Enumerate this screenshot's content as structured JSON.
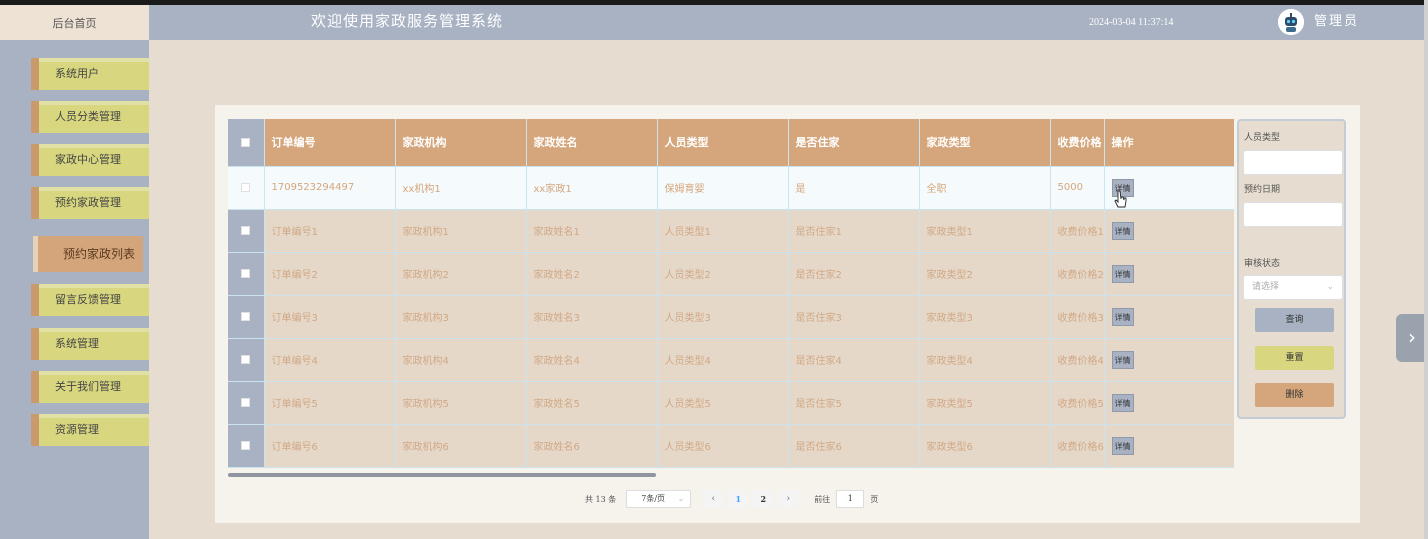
{
  "header": {
    "home_label": "后台首页",
    "system_title": "欢迎使用家政服务管理系统",
    "datetime": "2024-03-04 11:37:14",
    "admin_label": "管理员"
  },
  "sidebar": {
    "items": [
      {
        "label": "系统用户"
      },
      {
        "label": "人员分类管理"
      },
      {
        "label": "家政中心管理"
      },
      {
        "label": "预约家政管理"
      },
      {
        "label": "预约家政列表"
      },
      {
        "label": "留言反馈管理"
      },
      {
        "label": "系统管理"
      },
      {
        "label": "关于我们管理"
      },
      {
        "label": "资源管理"
      }
    ]
  },
  "table": {
    "headers": [
      "订单编号",
      "家政机构",
      "家政姓名",
      "人员类型",
      "是否住家",
      "家政类型",
      "收费价格",
      "操作"
    ],
    "detail_label": "详情",
    "rows": [
      [
        "1709523294497",
        "xx机构1",
        "xx家政1",
        "保姆育婴",
        "是",
        "全职",
        "5000"
      ],
      [
        "订单编号1",
        "家政机构1",
        "家政姓名1",
        "人员类型1",
        "是否住家1",
        "家政类型1",
        "收费价格1"
      ],
      [
        "订单编号2",
        "家政机构2",
        "家政姓名2",
        "人员类型2",
        "是否住家2",
        "家政类型2",
        "收费价格2"
      ],
      [
        "订单编号3",
        "家政机构3",
        "家政姓名3",
        "人员类型3",
        "是否住家3",
        "家政类型3",
        "收费价格3"
      ],
      [
        "订单编号4",
        "家政机构4",
        "家政姓名4",
        "人员类型4",
        "是否住家4",
        "家政类型4",
        "收费价格4"
      ],
      [
        "订单编号5",
        "家政机构5",
        "家政姓名5",
        "人员类型5",
        "是否住家5",
        "家政类型5",
        "收费价格5"
      ],
      [
        "订单编号6",
        "家政机构6",
        "家政姓名6",
        "人员类型6",
        "是否住家6",
        "家政类型6",
        "收费价格6"
      ]
    ]
  },
  "pager": {
    "total": "共 13 条",
    "page_size": "7条/页",
    "pages": [
      "1",
      "2"
    ],
    "current": "1",
    "goto_label": "前往",
    "goto_value": "1",
    "page_unit": "页"
  },
  "search": {
    "staff_type_label": "人员类型",
    "booking_date_label": "预约日期",
    "review_status_label": "审核状态",
    "review_status_placeholder": "请选择",
    "query_label": "查询",
    "reset_label": "重置",
    "delete_label": "删除"
  },
  "colors": {
    "header_bg": "#a8b2c2",
    "sidebar_item": "#d8d77f",
    "accent": "#d5a67b",
    "page_bg": "#e6dccf"
  },
  "icons": {
    "avatar": "robot-avatar-icon",
    "next": "chevron-right-icon",
    "select": "chevron-down-icon"
  }
}
